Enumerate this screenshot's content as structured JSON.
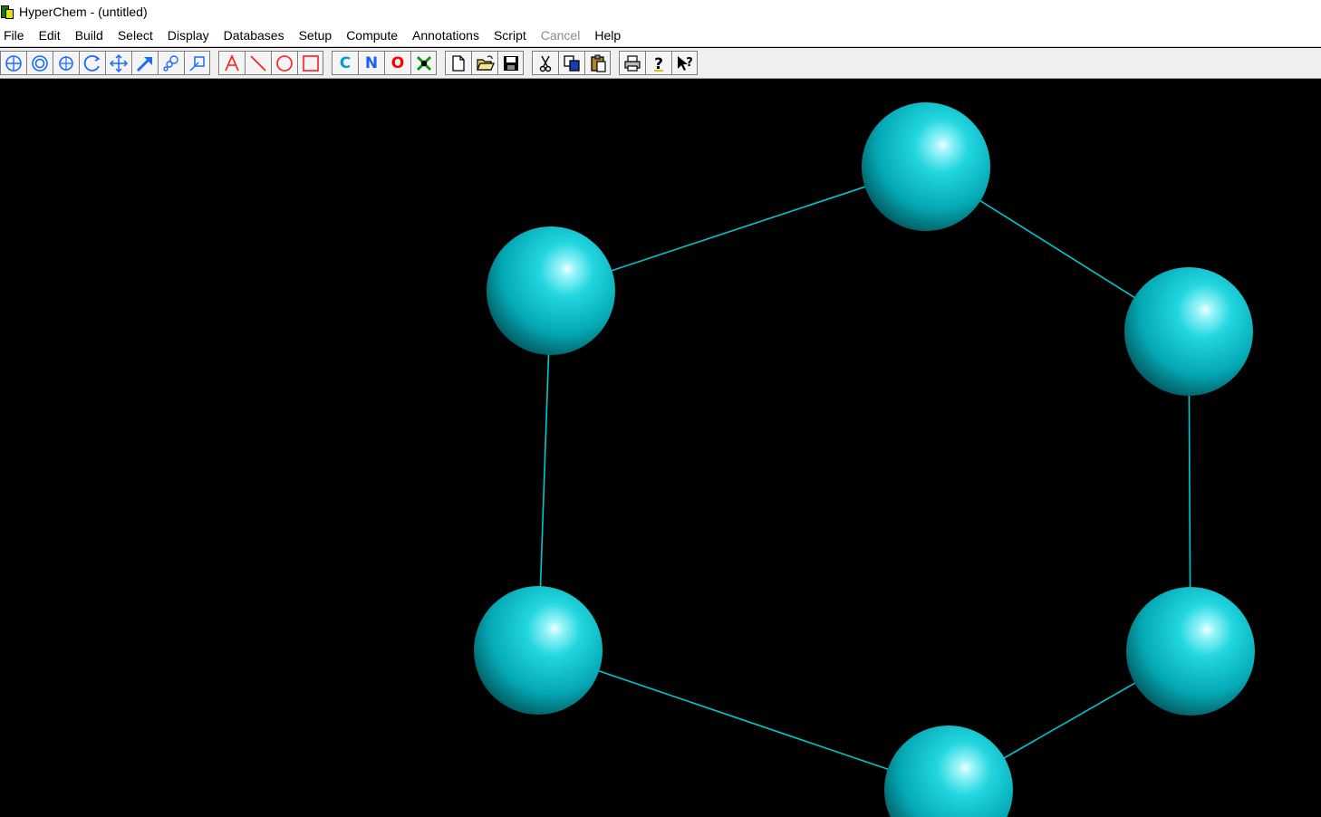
{
  "window": {
    "title": "HyperChem - (untitled)"
  },
  "menu": [
    {
      "label": "File",
      "enabled": true
    },
    {
      "label": "Edit",
      "enabled": true
    },
    {
      "label": "Build",
      "enabled": true
    },
    {
      "label": "Select",
      "enabled": true
    },
    {
      "label": "Display",
      "enabled": true
    },
    {
      "label": "Databases",
      "enabled": true
    },
    {
      "label": "Setup",
      "enabled": true
    },
    {
      "label": "Compute",
      "enabled": true
    },
    {
      "label": "Annotations",
      "enabled": true
    },
    {
      "label": "Script",
      "enabled": true
    },
    {
      "label": "Cancel",
      "enabled": false
    },
    {
      "label": "Help",
      "enabled": true
    }
  ],
  "toolbar": {
    "tool_icons": [
      "draw-tool-icon",
      "select-tool-icon",
      "rotate-xy-icon",
      "rotate-z-icon",
      "translate-xy-icon",
      "translate-z-icon",
      "zoom-tool-icon",
      "clip-tool-icon"
    ],
    "annotation_icons": [
      "text-annotation-icon",
      "line-annotation-icon",
      "ellipse-annotation-icon",
      "rectangle-annotation-icon"
    ],
    "element_buttons": [
      {
        "label": "C",
        "color": "#00a0d0"
      },
      {
        "label": "N",
        "color": "#1a5cff"
      },
      {
        "label": "O",
        "color": "#ff0000"
      }
    ],
    "file_icons": [
      "new-file-icon",
      "open-file-icon",
      "save-file-icon"
    ],
    "edit_icons": [
      "cut-icon",
      "copy-icon",
      "paste-icon"
    ],
    "help_icons": [
      "print-icon",
      "help-icon",
      "context-help-icon"
    ]
  },
  "molecule": {
    "atom_color": "#00c8d2",
    "bond_color": "#00c8d2",
    "atom_count": 6
  }
}
